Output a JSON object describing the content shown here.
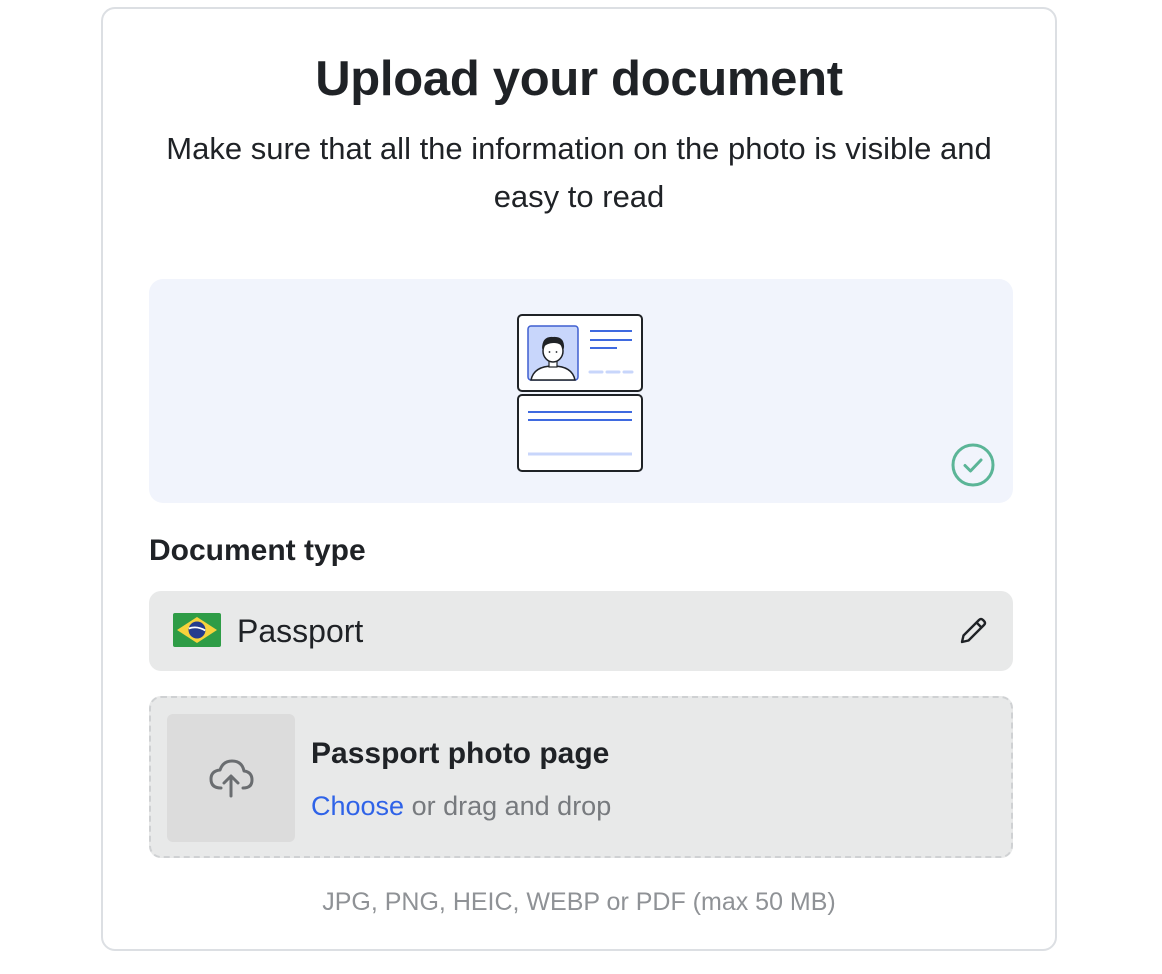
{
  "header": {
    "title": "Upload your document",
    "subtitle": "Make sure that all the information on the photo is visible and easy to read"
  },
  "illustration": {
    "icon": "id-document-illustration",
    "status_icon": "check-circle-icon"
  },
  "document_type": {
    "label": "Document type",
    "selected_value": "Passport",
    "flag_icon": "brazil-flag-icon",
    "edit_icon": "pencil-icon"
  },
  "upload": {
    "title": "Passport photo page",
    "choose_label": "Choose",
    "drag_text": " or drag and drop",
    "icon": "cloud-upload-icon"
  },
  "hint": "JPG, PNG, HEIC, WEBP or PDF (max 50 MB)",
  "colors": {
    "link": "#2f63e8",
    "success": "#5bb597",
    "illustration_bg": "#f1f4fc",
    "field_bg": "#e8e9e9"
  }
}
